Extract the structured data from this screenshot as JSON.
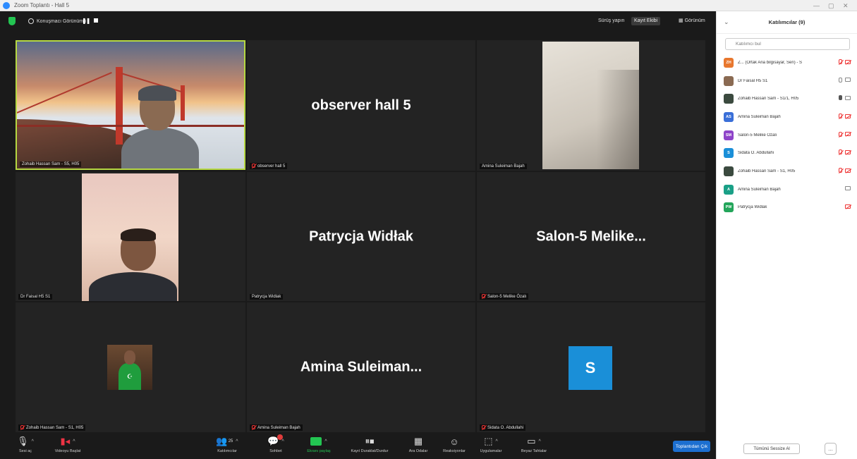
{
  "window": {
    "title": "Zoom Toplantı - Hall 5"
  },
  "topbar": {
    "view_label": "Konuşmacı Görünümü",
    "zoom_label": "Sürüş yapın",
    "exit_fullscreen": "Kayıt Ekibi",
    "layout_label": "Görünüm"
  },
  "tiles": [
    {
      "name": "Zohaib Hassan Sam - S5, H05",
      "big": ""
    },
    {
      "name": "observer hall 5",
      "big": "observer hall 5"
    },
    {
      "name": "Amina Suleiman Bajah",
      "big": ""
    },
    {
      "name": "Dr Faisal H5 S1",
      "big": ""
    },
    {
      "name": "Patrycja Widlak",
      "big": "Patrycja Widłak"
    },
    {
      "name": "Salon-5 Melike Özalı",
      "big": "Salon-5  Melike..."
    },
    {
      "name": "Zohaib Hassan Sam - S1, H05",
      "big": ""
    },
    {
      "name": "Amina Suleiman Bajah",
      "big": "Amina  Suleiman..."
    },
    {
      "name": "Sidata O. Abdullahi",
      "big": "",
      "avatar": "S"
    }
  ],
  "toolbar": {
    "items": [
      {
        "label": "Sesi aç",
        "icon": "mic-icon"
      },
      {
        "label": "Videoyu Başlat",
        "icon": "video-icon"
      },
      {
        "label": "Katılımcılar",
        "icon": "participants-icon",
        "count": "25"
      },
      {
        "label": "Sohbet",
        "icon": "chat-icon"
      },
      {
        "label": "Ekranı paylaş",
        "icon": "share-screen-icon"
      },
      {
        "label": "Kayıt Duraklat/Durdur",
        "icon": "record-icon"
      },
      {
        "label": "Ara Odalar",
        "icon": "breakout-rooms-icon"
      },
      {
        "label": "Reaksiyonlar",
        "icon": "reactions-icon"
      },
      {
        "label": "Uygulamalar",
        "icon": "apps-icon"
      },
      {
        "label": "Beyaz Tahtalar",
        "icon": "whiteboard-icon"
      }
    ],
    "leave": "Toplantıdan Çık"
  },
  "panel": {
    "title": "Katılımcılar (9)",
    "search_placeholder": "Katılımcı bul",
    "participants": [
      {
        "initials": "ZH",
        "color": "#e8772e",
        "name": "Z... (Ortak Ana bilgisayar, Sen) - S",
        "mic": "muted",
        "cam": "muted"
      },
      {
        "initials": "",
        "color": "#8a6a52",
        "name": "Dr Faisal H5 S1",
        "mic": "off",
        "cam": "off"
      },
      {
        "initials": "",
        "color": "#3b4a3f",
        "name": "Zohaib Hassan Sam - S1/1, H05",
        "mic": "on",
        "cam": "off"
      },
      {
        "initials": "AS",
        "color": "#3a6fd8",
        "name": "Amina Suleiman Bajah",
        "mic": "muted",
        "cam": "muted"
      },
      {
        "initials": "SM",
        "color": "#8e44c9",
        "name": "Salon-5 Melike Özalı",
        "mic": "muted",
        "cam": "muted"
      },
      {
        "initials": "S",
        "color": "#1a8fd8",
        "name": "Sidata O. Abdullahi",
        "mic": "muted",
        "cam": "muted"
      },
      {
        "initials": "",
        "color": "#3b4a3f",
        "name": "Zohaib Hassan Sam - S1, H05",
        "mic": "muted",
        "cam": "muted"
      },
      {
        "initials": "A",
        "color": "#1aa087",
        "name": "Amina Suleiman Bajah",
        "mic": "",
        "cam": "off"
      },
      {
        "initials": "PW",
        "color": "#23a55a",
        "name": "Patrycja Widlak",
        "mic": "",
        "cam": "muted"
      }
    ],
    "mute_all": "Tümünü Sessize Al",
    "more": "..."
  }
}
